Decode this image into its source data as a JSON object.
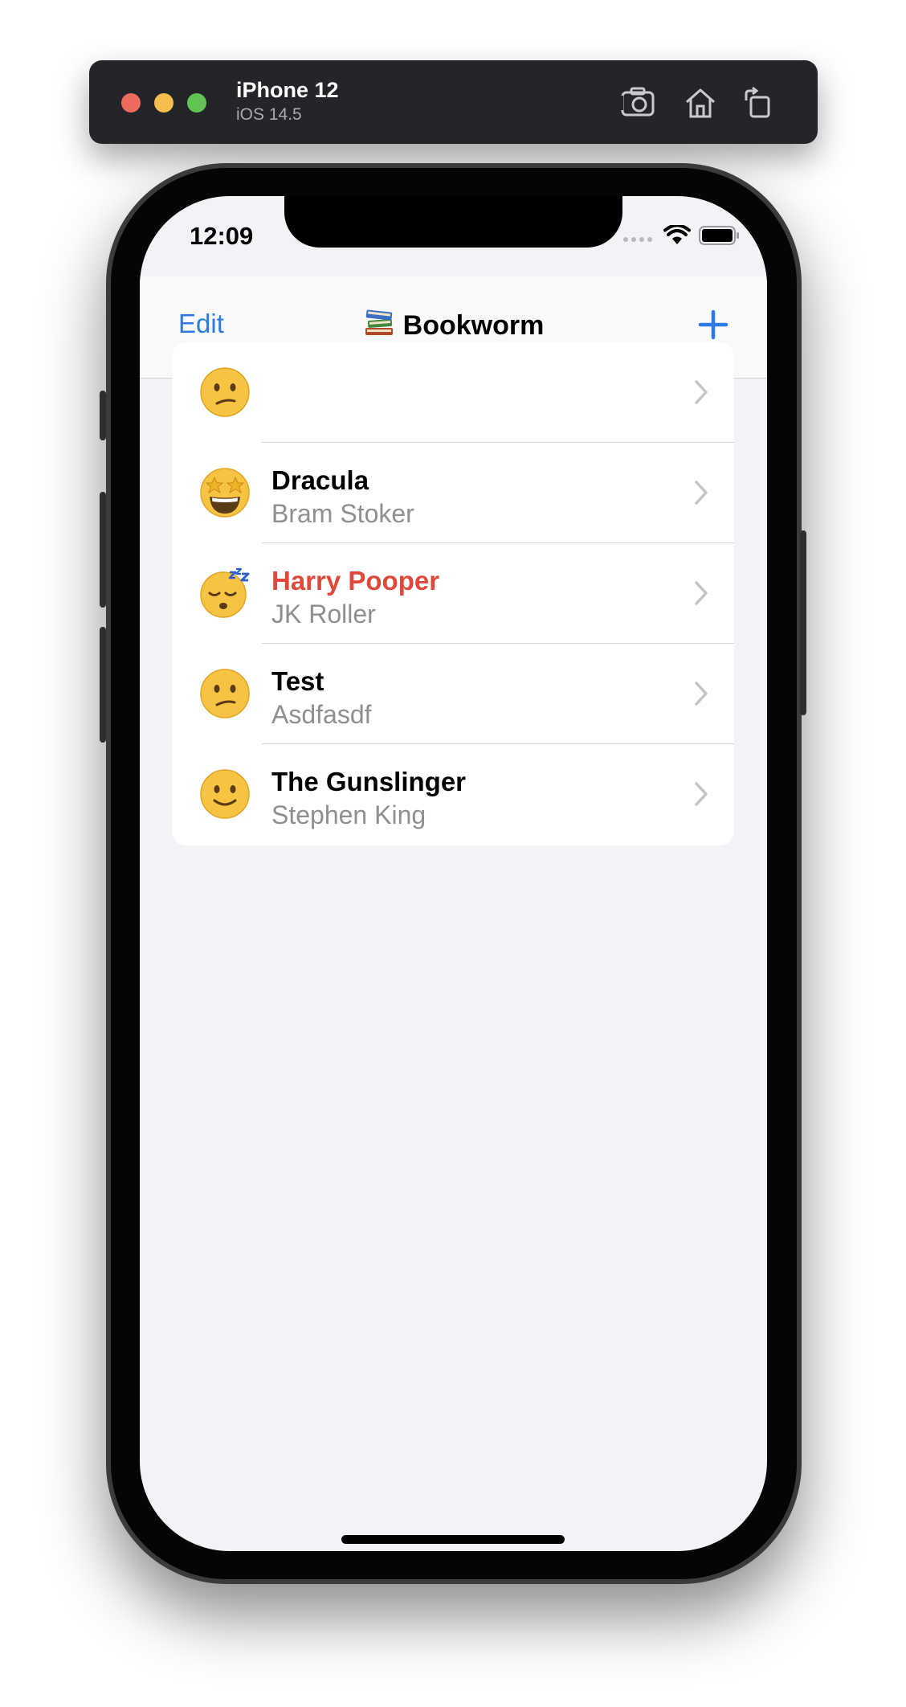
{
  "simulator": {
    "device_name": "iPhone 12",
    "os_version": "iOS 14.5",
    "tools": [
      "screenshot-icon",
      "home-icon",
      "rotate-icon"
    ]
  },
  "status_bar": {
    "time": "12:09",
    "icons": [
      "cellular-icon",
      "wifi-icon",
      "battery-icon"
    ]
  },
  "nav": {
    "edit_label": "Edit",
    "title_icon": "books-icon",
    "title": "Bookworm",
    "add_icon": "plus-icon"
  },
  "colors": {
    "accent": "#2c7be5",
    "low_rating": "#e0483b",
    "secondary_text": "#8e8e93",
    "background": "#f2f2f7"
  },
  "books": [
    {
      "title": "",
      "author": "",
      "rating_emoji": "confused-face-icon",
      "low_rated": false
    },
    {
      "title": "Dracula",
      "author": "Bram Stoker",
      "rating_emoji": "star-struck-icon",
      "low_rated": false
    },
    {
      "title": "Harry Pooper",
      "author": "JK Roller",
      "rating_emoji": "sleeping-face-icon",
      "low_rated": true
    },
    {
      "title": "Test",
      "author": "Asdfasdf",
      "rating_emoji": "confused-face-icon",
      "low_rated": false
    },
    {
      "title": "The Gunslinger",
      "author": "Stephen King",
      "rating_emoji": "slightly-smiling-face-icon",
      "low_rated": false
    }
  ]
}
